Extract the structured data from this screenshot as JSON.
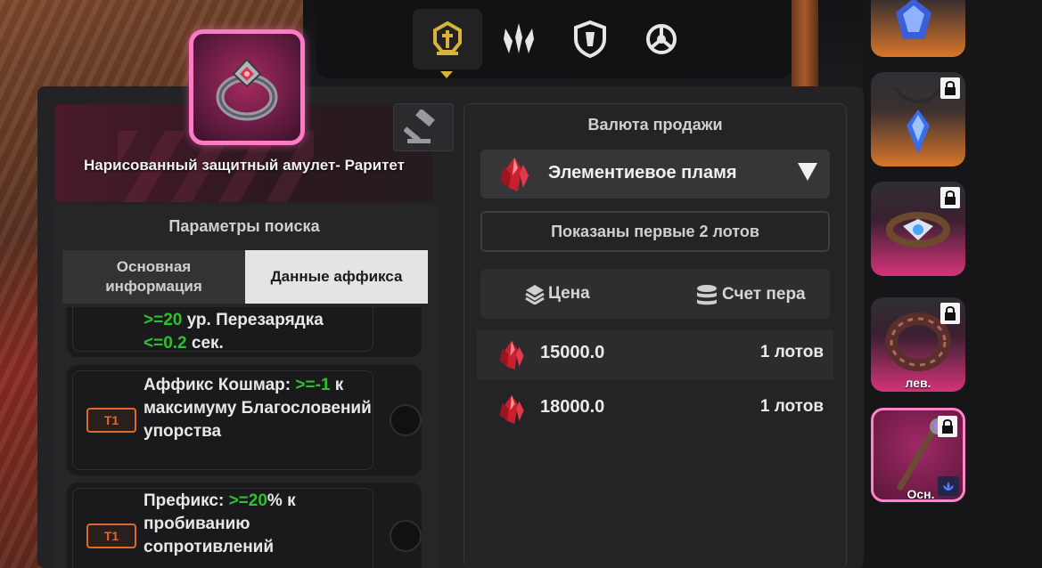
{
  "item": {
    "name": "Нарисованный защитный амулет- Раритет",
    "rarity_color": "#ff7ac4"
  },
  "top_tabs": [
    {
      "icon": "helmet-icon",
      "active": true
    },
    {
      "icon": "blades-icon",
      "active": false
    },
    {
      "icon": "shield-icon",
      "active": false
    },
    {
      "icon": "crosshair-icon",
      "active": false
    }
  ],
  "left": {
    "search_params_label": "Параметры поиска",
    "tab_basic": "Основная информация",
    "tab_affix": "Данные аффикса"
  },
  "affixes": [
    {
      "line1_prefix": ">=20",
      "line1_text": " ур. Перезарядка",
      "line2_value": "<=0.2",
      "line2_text": " сек."
    },
    {
      "tier": "T1",
      "label": "Аффикс Кошмар: ",
      "value": ">=-1",
      "rest": " к максимуму Благословений упорства"
    },
    {
      "tier": "T1",
      "label": "Префикс: ",
      "value": ">=20",
      "rest": "% к пробиванию сопротивлений"
    }
  ],
  "right": {
    "currency_title": "Валюта продажи",
    "currency_name": "Элементиевое пламя",
    "shown_text": "Показаны первые 2 лотов",
    "col_price": "Цена",
    "col_count": "Счет пера"
  },
  "listings": [
    {
      "price": "15000.0",
      "lots": "1 лотов"
    },
    {
      "price": "18000.0",
      "lots": "1 лотов"
    }
  ],
  "inventory": [
    {
      "icon": "crystal-amulet-icon",
      "rarity": "orange",
      "locked": true,
      "label": ""
    },
    {
      "icon": "blue-pendant-icon",
      "rarity": "orange",
      "locked": true,
      "label": ""
    },
    {
      "icon": "winged-belt-icon",
      "rarity": "pink",
      "locked": true,
      "label": ""
    },
    {
      "icon": "spiked-bracer-icon",
      "rarity": "pink",
      "locked": true,
      "label": "лев."
    },
    {
      "icon": "staff-icon",
      "rarity": "pink-selected",
      "locked": true,
      "label": "Осн."
    }
  ],
  "colors": {
    "green_value": "#2fbf2f",
    "tier_orange": "#e0682a",
    "tab_gold": "#d9b23a",
    "gem_red": "#c8202e"
  }
}
